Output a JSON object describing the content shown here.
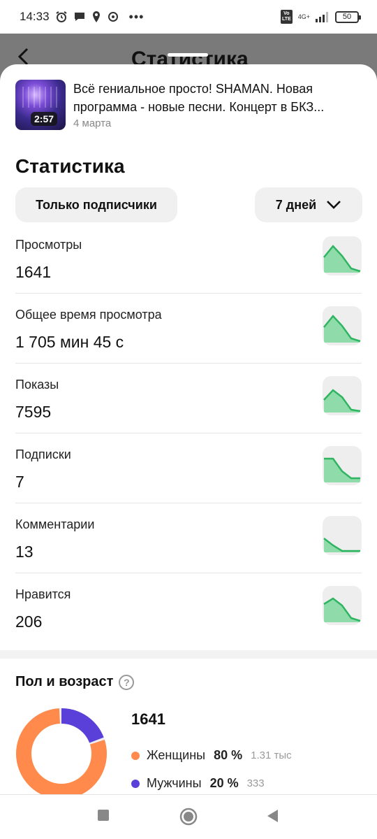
{
  "status_bar": {
    "time": "14:33",
    "network_label": "4G+",
    "volte_label": "Vo LTE",
    "battery": "50"
  },
  "header": {
    "back_icon": "chevron-left-icon",
    "title": "Статистика"
  },
  "video": {
    "title": "Всё гениальное просто! SHAMAN. Новая программа - новые песни. Концерт в БКЗ...",
    "duration": "2:57",
    "date": "4 марта"
  },
  "stats": {
    "title": "Статистика",
    "audience_filter": "Только подписчики",
    "period_filter": "7 дней",
    "metrics": [
      {
        "label": "Просмотры",
        "value": "1641",
        "trend": [
          0.55,
          0.95,
          0.6,
          0.15,
          0.05
        ]
      },
      {
        "label": "Общее время просмотра",
        "value": "1 705 мин 45 с",
        "trend": [
          0.55,
          0.95,
          0.6,
          0.15,
          0.05
        ]
      },
      {
        "label": "Показы",
        "value": "7595",
        "trend": [
          0.45,
          0.8,
          0.55,
          0.1,
          0.05
        ]
      },
      {
        "label": "Подписки",
        "value": "7",
        "trend": [
          0.85,
          0.85,
          0.4,
          0.15,
          0.15
        ]
      },
      {
        "label": "Комментарии",
        "value": "13",
        "trend": [
          0.5,
          0.25,
          0.05,
          0.05,
          0.05
        ]
      },
      {
        "label": "Нравится",
        "value": "206",
        "trend": [
          0.65,
          0.85,
          0.6,
          0.15,
          0.05
        ]
      }
    ]
  },
  "demographics": {
    "title": "Пол и возраст",
    "total": "1641",
    "colors": {
      "women": "#ff8a4c",
      "men": "#5b3fd9",
      "spark_fill": "#8fdcaa",
      "spark_line": "#2fb561"
    },
    "groups": [
      {
        "label": "Женщины",
        "percent": "80 %",
        "absolute": "1.31 тыс",
        "share": 0.8
      },
      {
        "label": "Мужчины",
        "percent": "20 %",
        "absolute": "333",
        "share": 0.2
      }
    ]
  }
}
